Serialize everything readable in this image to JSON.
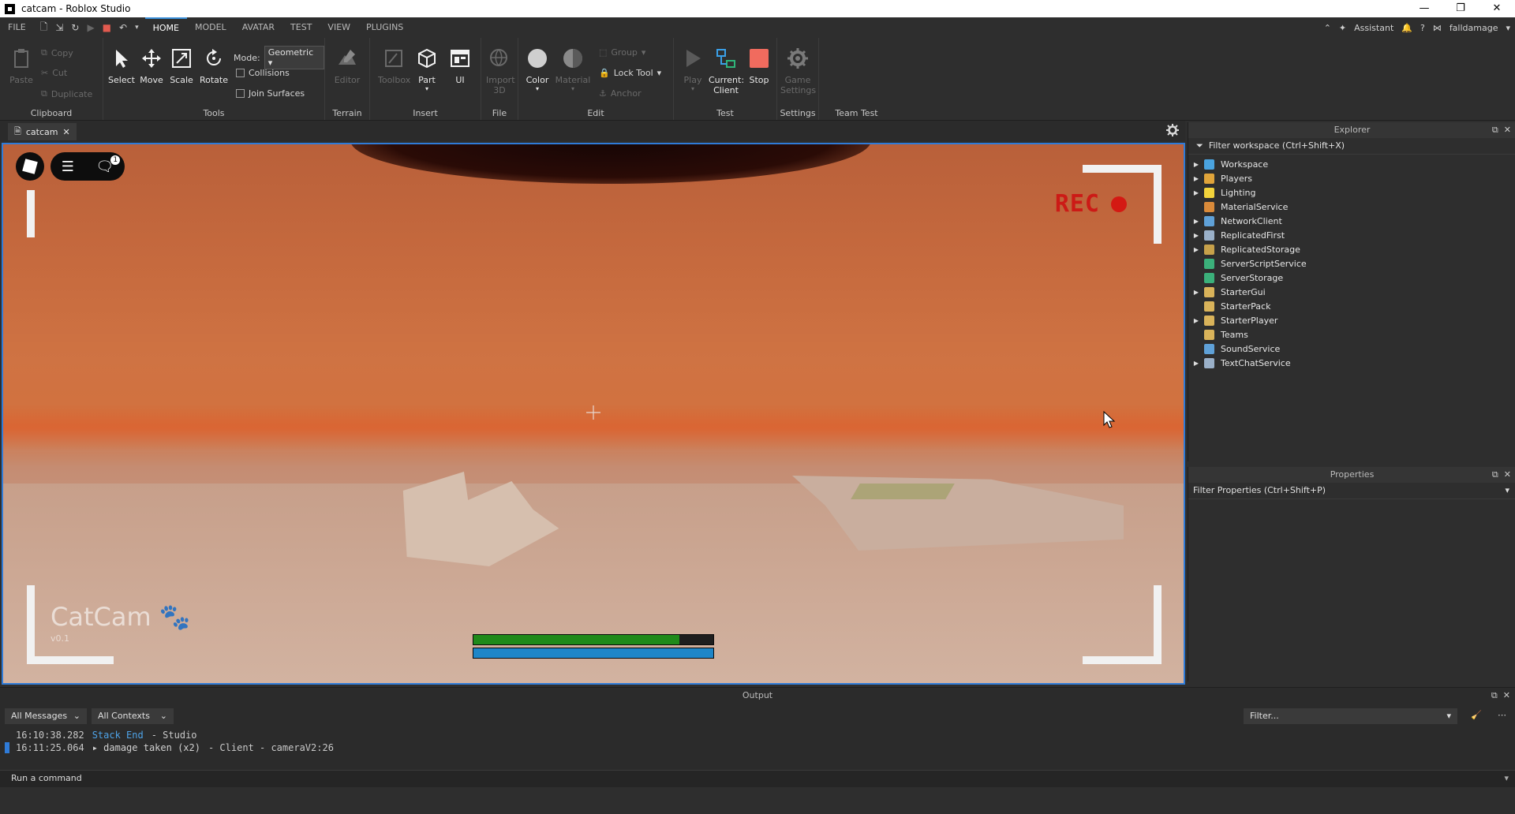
{
  "window": {
    "title": "catcam - Roblox Studio"
  },
  "menu": {
    "file": "FILE",
    "tabs": [
      "HOME",
      "MODEL",
      "AVATAR",
      "TEST",
      "VIEW",
      "PLUGINS"
    ],
    "active_tab": "HOME",
    "assistant": "Assistant",
    "user": "falldamage"
  },
  "ribbon": {
    "clipboard": {
      "label": "Clipboard",
      "paste": "Paste",
      "copy": "Copy",
      "cut": "Cut",
      "duplicate": "Duplicate"
    },
    "tools": {
      "label": "Tools",
      "select": "Select",
      "move": "Move",
      "scale": "Scale",
      "rotate": "Rotate",
      "mode_label": "Mode:",
      "mode_value": "Geometric",
      "collisions": "Collisions",
      "join_surfaces": "Join Surfaces"
    },
    "terrain": {
      "label": "Terrain",
      "editor": "Editor"
    },
    "insert": {
      "label": "Insert",
      "toolbox": "Toolbox",
      "part": "Part",
      "ui": "UI"
    },
    "file": {
      "label": "File",
      "import_3d": "Import 3D"
    },
    "edit": {
      "label": "Edit",
      "color": "Color",
      "material": "Material",
      "group": "Group",
      "lock_tool": "Lock Tool",
      "anchor": "Anchor"
    },
    "test": {
      "label": "Test",
      "play": "Play",
      "current_client_1": "Current:",
      "current_client_2": "Client",
      "stop": "Stop"
    },
    "settings": {
      "label": "Settings",
      "game_settings_1": "Game",
      "game_settings_2": "Settings"
    },
    "team_test": {
      "label": "Team Test"
    }
  },
  "doc_tab": {
    "name": "catcam"
  },
  "viewport": {
    "rec": "REC",
    "catcam": "CatCam",
    "version": "v0.1",
    "chat_badge": "1",
    "health_fraction": 0.86,
    "stamina_fraction": 1.0,
    "colors": {
      "health": "#1f8a1a",
      "stamina": "#1e86c8",
      "rec": "#d41913"
    }
  },
  "explorer": {
    "title": "Explorer",
    "filter": "Filter workspace (Ctrl+Shift+X)",
    "items": [
      {
        "label": "Workspace",
        "expandable": true,
        "color": "#4aa3df"
      },
      {
        "label": "Players",
        "expandable": true,
        "color": "#e0a43a"
      },
      {
        "label": "Lighting",
        "expandable": true,
        "color": "#f2d33b"
      },
      {
        "label": "MaterialService",
        "expandable": false,
        "color": "#d98a3a"
      },
      {
        "label": "NetworkClient",
        "expandable": true,
        "color": "#5fa1d8"
      },
      {
        "label": "ReplicatedFirst",
        "expandable": true,
        "color": "#9ab0c8"
      },
      {
        "label": "ReplicatedStorage",
        "expandable": true,
        "color": "#c7a14a"
      },
      {
        "label": "ServerScriptService",
        "expandable": false,
        "color": "#3bb07a"
      },
      {
        "label": "ServerStorage",
        "expandable": false,
        "color": "#3bb07a"
      },
      {
        "label": "StarterGui",
        "expandable": true,
        "color": "#d9b35a"
      },
      {
        "label": "StarterPack",
        "expandable": false,
        "color": "#d9b35a"
      },
      {
        "label": "StarterPlayer",
        "expandable": true,
        "color": "#d9b35a"
      },
      {
        "label": "Teams",
        "expandable": false,
        "color": "#d9b35a"
      },
      {
        "label": "SoundService",
        "expandable": false,
        "color": "#5fa1d8"
      },
      {
        "label": "TextChatService",
        "expandable": true,
        "color": "#9ab0c8"
      }
    ]
  },
  "properties": {
    "title": "Properties",
    "filter": "Filter Properties (Ctrl+Shift+P)"
  },
  "output": {
    "title": "Output",
    "messages_filter": "All Messages",
    "contexts_filter": "All Contexts",
    "filter_placeholder": "Filter...",
    "logs": [
      {
        "time": "16:10:38.282",
        "text": "Stack End",
        "source": "-  Studio",
        "bar_color": "#2b2b2b",
        "text_color": "#4ea3e8"
      },
      {
        "time": "16:11:25.064",
        "text": "▸ damage taken (x2)",
        "source": "-  Client - cameraV2:26",
        "bar_color": "#2f7bd8",
        "text_color": "#d0d0d0"
      }
    ]
  },
  "command_bar": {
    "placeholder": "Run a command"
  }
}
